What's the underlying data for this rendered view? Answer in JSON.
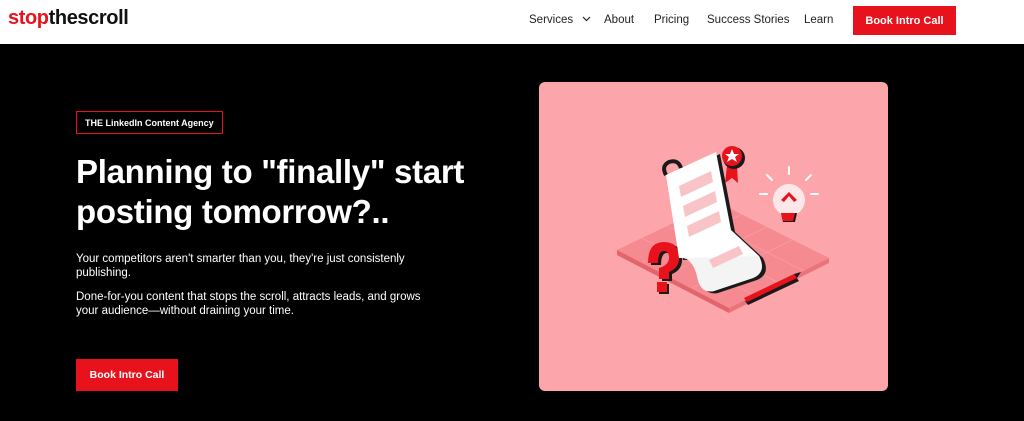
{
  "header": {
    "logo": {
      "part1": "stop",
      "part2": "thescroll"
    },
    "nav": [
      {
        "label": "Services"
      },
      {
        "label": "About"
      },
      {
        "label": "Pricing"
      },
      {
        "label": "Success Stories"
      },
      {
        "label": "Learn"
      }
    ],
    "cta_label": "Book Intro Call"
  },
  "hero": {
    "tag": "THE LinkedIn Content Agency",
    "title_line1": "Planning to \"finally\" start",
    "title_line2": "posting tomorrow?..",
    "paragraph1": "Your competitors aren't smarter than you, they're just consistenly publishing.",
    "paragraph2": "Done-for-you content that stops the scroll, attracts leads, and grows your audience—without draining your time.",
    "cta_label": "Book Intro Call"
  },
  "colors": {
    "brand_red": "#e8121d",
    "hero_bg": "#000000",
    "illustration_bg": "#fca5aa"
  },
  "icons": [
    "chevron-down-icon",
    "document-scroll-icon",
    "lightbulb-icon",
    "question-mark-icon",
    "pencil-icon",
    "award-badge-icon"
  ]
}
